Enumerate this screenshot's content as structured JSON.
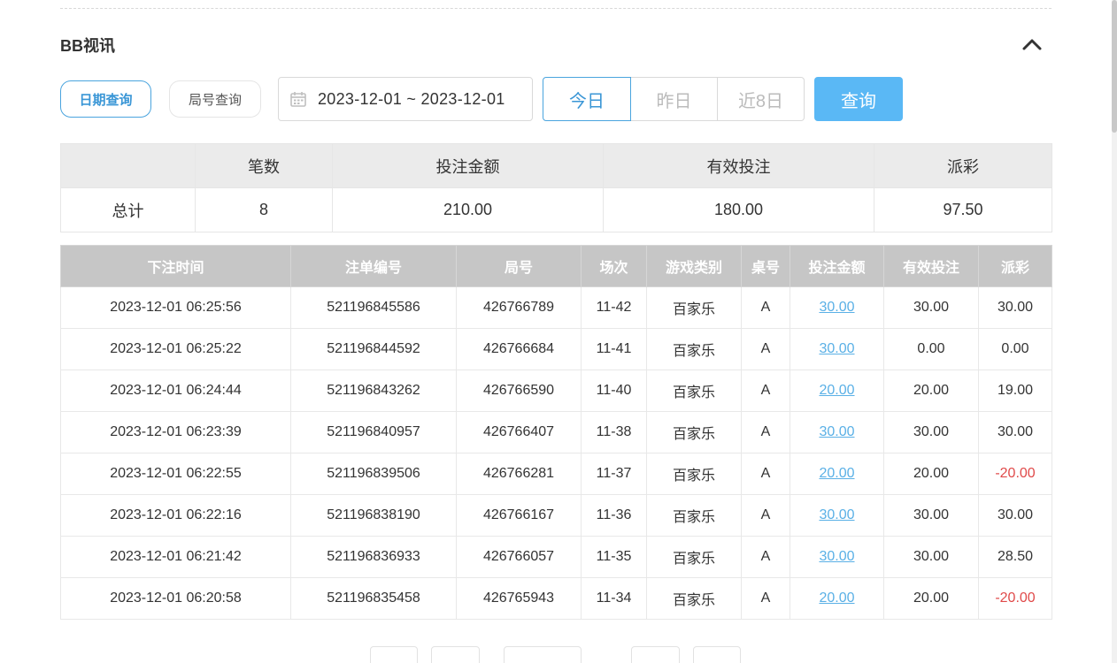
{
  "section": {
    "title": "BB视讯"
  },
  "filters": {
    "mode_date": "日期查询",
    "mode_round": "局号查询",
    "date_range": "2023-12-01 ~ 2023-12-01",
    "quick": [
      "今日",
      "昨日",
      "近8日"
    ],
    "query": "查询"
  },
  "summary": {
    "headers": [
      "",
      "笔数",
      "投注金额",
      "有效投注",
      "派彩"
    ],
    "row": [
      "总计",
      "8",
      "210.00",
      "180.00",
      "97.50"
    ]
  },
  "table": {
    "headers": [
      "下注时间",
      "注单编号",
      "局号",
      "场次",
      "游戏类别",
      "桌号",
      "投注金额",
      "有效投注",
      "派彩"
    ],
    "rows": [
      [
        "2023-12-01 06:25:56",
        "521196845586",
        "426766789",
        "11-42",
        "百家乐",
        "A",
        "30.00",
        "30.00",
        "30.00"
      ],
      [
        "2023-12-01 06:25:22",
        "521196844592",
        "426766684",
        "11-41",
        "百家乐",
        "A",
        "30.00",
        "0.00",
        "0.00"
      ],
      [
        "2023-12-01 06:24:44",
        "521196843262",
        "426766590",
        "11-40",
        "百家乐",
        "A",
        "20.00",
        "20.00",
        "19.00"
      ],
      [
        "2023-12-01 06:23:39",
        "521196840957",
        "426766407",
        "11-38",
        "百家乐",
        "A",
        "30.00",
        "30.00",
        "30.00"
      ],
      [
        "2023-12-01 06:22:55",
        "521196839506",
        "426766281",
        "11-37",
        "百家乐",
        "A",
        "20.00",
        "20.00",
        "-20.00"
      ],
      [
        "2023-12-01 06:22:16",
        "521196838190",
        "426766167",
        "11-36",
        "百家乐",
        "A",
        "30.00",
        "30.00",
        "30.00"
      ],
      [
        "2023-12-01 06:21:42",
        "521196836933",
        "426766057",
        "11-35",
        "百家乐",
        "A",
        "30.00",
        "30.00",
        "28.50"
      ],
      [
        "2023-12-01 06:20:58",
        "521196835458",
        "426765943",
        "11-34",
        "百家乐",
        "A",
        "20.00",
        "20.00",
        "-20.00"
      ]
    ]
  },
  "colors": {
    "accent": "#3a96d6",
    "query_bg": "#5ab8f5",
    "negative": "#e04a4a",
    "link": "#5ab0e6"
  },
  "icons": {
    "calendar": "calendar-icon",
    "collapse": "chevron-up-icon"
  }
}
